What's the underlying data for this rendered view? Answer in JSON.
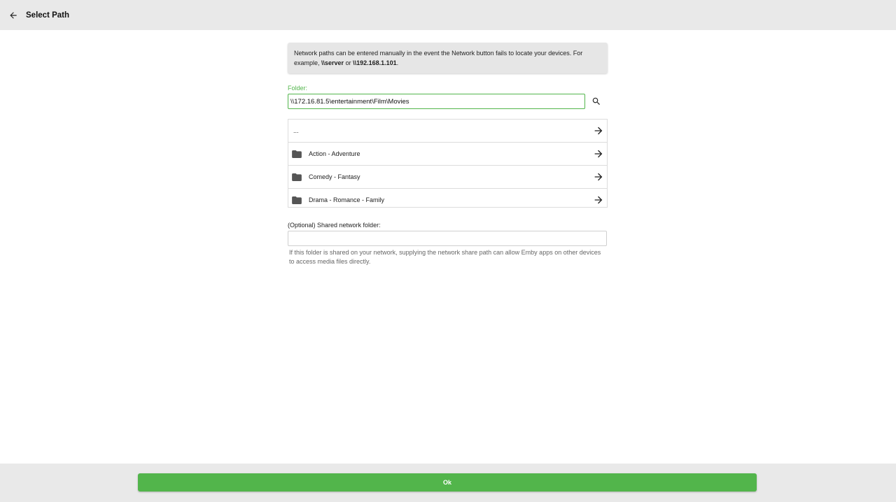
{
  "header": {
    "title": "Select Path",
    "back_icon": "arrow-left-icon"
  },
  "info": {
    "text_before": "Network paths can be entered manually in the event the Network button fails to locate your devices. For example, ",
    "example1": "\\\\server",
    "text_mid": " or ",
    "example2": "\\\\192.168.1.101",
    "text_after": "."
  },
  "folder": {
    "label": "Folder:",
    "value": "\\\\172.16.81.5\\entertainment\\Film\\Movies",
    "search_icon": "search-icon"
  },
  "list": {
    "parent_label": "...",
    "items": [
      {
        "label": "Action - Adventure"
      },
      {
        "label": "Comedy - Fantasy"
      },
      {
        "label": "Drama - Romance - Family"
      }
    ]
  },
  "shared": {
    "label": "(Optional) Shared network folder:",
    "value": "",
    "help": "If this folder is shared on your network, supplying the network share path can allow Emby apps on other devices to access media files directly."
  },
  "footer": {
    "ok_label": "Ok"
  },
  "colors": {
    "accent": "#52b54b",
    "header_bg": "#e9e9e9",
    "info_bg": "#e6e6e6"
  }
}
